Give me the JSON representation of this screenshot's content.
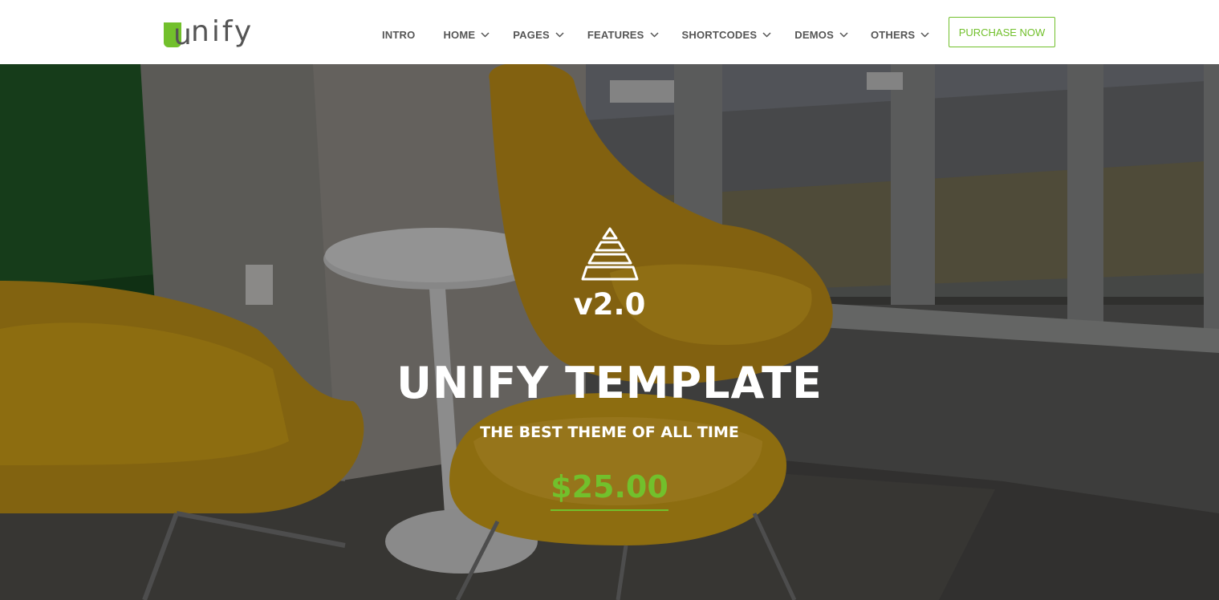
{
  "header": {
    "logo_text": "unify",
    "logo_first_letter": "u",
    "logo_rest": "nify",
    "nav": [
      {
        "label": "INTRO",
        "has_dropdown": false
      },
      {
        "label": "HOME",
        "has_dropdown": true
      },
      {
        "label": "PAGES",
        "has_dropdown": true
      },
      {
        "label": "FEATURES",
        "has_dropdown": true
      },
      {
        "label": "SHORTCODES",
        "has_dropdown": true
      },
      {
        "label": "DEMOS",
        "has_dropdown": true
      },
      {
        "label": "OTHERS",
        "has_dropdown": true
      }
    ],
    "purchase_label": "PURCHASE NOW"
  },
  "hero": {
    "icon": "pyramid-icon",
    "version": "v2.0",
    "title": "UNIFY TEMPLATE",
    "subtitle": "THE BEST THEME OF ALL TIME",
    "price": "$25.00"
  },
  "colors": {
    "accent": "#72c02c",
    "nav_text": "#555555",
    "hero_text": "#ffffff",
    "chair_yellow": "#d9a81a"
  }
}
